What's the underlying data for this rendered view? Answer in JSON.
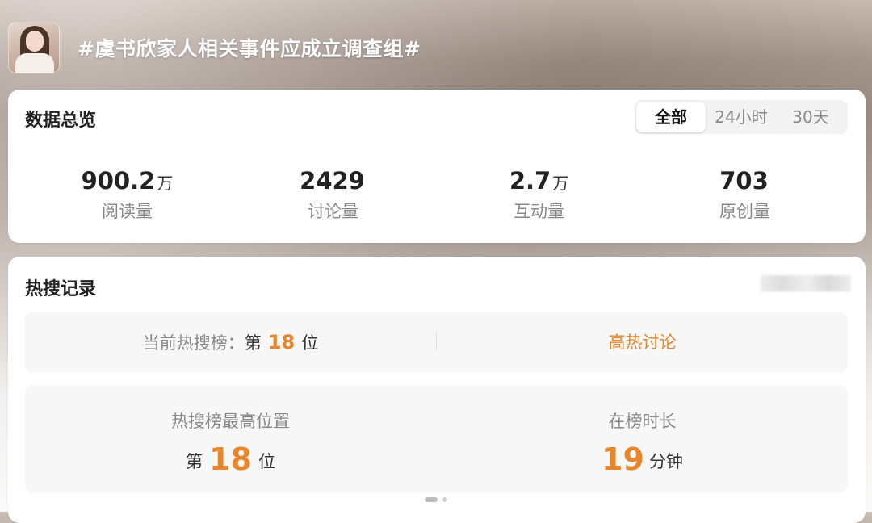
{
  "header": {
    "title": "#虞书欣家人相关事件应成立调查组#"
  },
  "overview": {
    "title": "数据总览",
    "tabs": [
      {
        "label": "全部",
        "active": true
      },
      {
        "label": "24小时",
        "active": false
      },
      {
        "label": "30天",
        "active": false
      }
    ],
    "stats": [
      {
        "value": "900.2",
        "unit": "万",
        "label": "阅读量"
      },
      {
        "value": "2429",
        "unit": "",
        "label": "讨论量"
      },
      {
        "value": "2.7",
        "unit": "万",
        "label": "互动量"
      },
      {
        "value": "703",
        "unit": "",
        "label": "原创量"
      }
    ]
  },
  "hot_search": {
    "title": "热搜记录",
    "current": {
      "label": "当前热搜榜：",
      "prefix": "第",
      "rank": "18",
      "suffix": "位",
      "tag": "高热讨论"
    },
    "highest": {
      "label": "热搜榜最高位置",
      "prefix": "第",
      "rank": "18",
      "suffix": "位"
    },
    "duration": {
      "label": "在榜时长",
      "value": "19",
      "unit": "分钟"
    }
  },
  "colors": {
    "accent": "#e7862a",
    "muted_text": "#888888",
    "card_bg": "#ffffff",
    "panel_bg": "#f7f7f7"
  }
}
